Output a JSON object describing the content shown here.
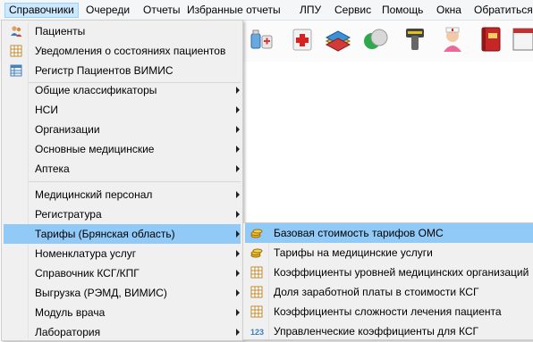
{
  "menubar": {
    "items": [
      {
        "label": "Справочники",
        "name": "menu-reference"
      },
      {
        "label": "Очереди",
        "name": "menu-queues"
      },
      {
        "label": "Отчеты",
        "name": "menu-reports"
      },
      {
        "label": "Избранные отчеты",
        "name": "menu-favorite-reports"
      },
      {
        "label": "ЛПУ",
        "name": "menu-lpu"
      },
      {
        "label": "Сервис",
        "name": "menu-service"
      },
      {
        "label": "Помощь",
        "name": "menu-help"
      },
      {
        "label": "Окна",
        "name": "menu-windows"
      },
      {
        "label": "Обратиться",
        "name": "menu-contact"
      }
    ]
  },
  "toolbar": {
    "icons": [
      "medicine-bottles-icon",
      "first-aid-kit-icon",
      "books-icon",
      "pill-capsule-icon",
      "barcode-scanner-icon",
      "nurse-icon",
      "red-book-icon",
      "document-window-icon"
    ]
  },
  "dropdown": {
    "items": [
      {
        "label": "Пациенты",
        "icon": "patients-icon"
      },
      {
        "label": "Уведомления о состояниях пациентов",
        "icon": "grid-table-icon"
      },
      {
        "label": "Регистр Пациентов ВИМИС",
        "icon": "grid-table-blue-icon"
      },
      {
        "label": "Общие классификаторы",
        "submenu": true
      },
      {
        "label": "НСИ",
        "submenu": true
      },
      {
        "label": "Организации",
        "submenu": true
      },
      {
        "label": "Основные медицинские",
        "submenu": true
      },
      {
        "label": "Аптека",
        "submenu": true
      },
      {
        "label": "Медицинский персонал",
        "submenu": true
      },
      {
        "label": "Регистратура",
        "submenu": true
      },
      {
        "label": "Тарифы (Брянская область)",
        "submenu": true
      },
      {
        "label": "Номенклатура услуг",
        "submenu": true
      },
      {
        "label": "Справочник КСГ/КПГ",
        "submenu": true
      },
      {
        "label": "Выгрузка (РЭМД, ВИМИС)",
        "submenu": true
      },
      {
        "label": "Модуль врача",
        "submenu": true
      },
      {
        "label": "Лаборатория",
        "submenu": true
      }
    ]
  },
  "submenu": {
    "items": [
      {
        "label": "Базовая стоимость тарифов ОМС",
        "icon": "coins-icon"
      },
      {
        "label": "Тарифы на медицинские услуги",
        "icon": "coins-icon"
      },
      {
        "label": "Коэффициенты уровней медицинских организаций",
        "icon": "grid-table-icon"
      },
      {
        "label": "Доля заработной платы в стоимости КСГ",
        "icon": "grid-table-icon"
      },
      {
        "label": "Коэффициенты сложности лечения пациента",
        "icon": "grid-table-icon"
      },
      {
        "label": "Управленческие коэффициенты для КСГ",
        "icon": "numbers-123-icon",
        "icon_text": "123"
      }
    ]
  },
  "colors": {
    "highlight": "#91c9f7",
    "menu_active": "#cce8ff",
    "menu_bg": "#f0f0f0"
  }
}
